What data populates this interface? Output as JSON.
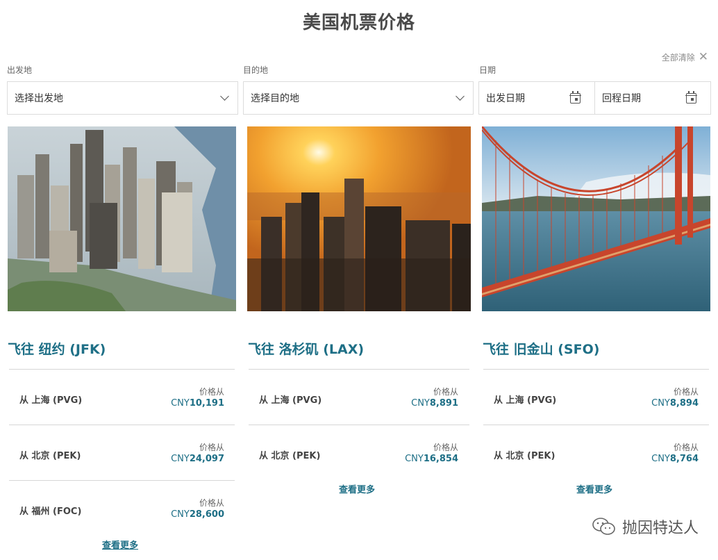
{
  "page_title": "美国机票价格",
  "clear_all": "全部清除",
  "filters": {
    "origin": {
      "label": "出发地",
      "value": "选择出发地"
    },
    "destination": {
      "label": "目的地",
      "value": "选择目的地"
    },
    "date": {
      "label": "日期",
      "depart": "出发日期",
      "return": "回程日期"
    }
  },
  "cards": [
    {
      "title": "飞往 纽约 (JFK)",
      "routes": [
        {
          "from": "从 上海 (PVG)",
          "price_label": "价格从",
          "currency": "CNY",
          "amount": "10,191"
        },
        {
          "from": "从 北京 (PEK)",
          "price_label": "价格从",
          "currency": "CNY",
          "amount": "24,097"
        },
        {
          "from": "从 福州 (FOC)",
          "price_label": "价格从",
          "currency": "CNY",
          "amount": "28,600"
        }
      ],
      "more": "查看更多"
    },
    {
      "title": "飞往 洛杉矶 (LAX)",
      "routes": [
        {
          "from": "从 上海 (PVG)",
          "price_label": "价格从",
          "currency": "CNY",
          "amount": "8,891"
        },
        {
          "from": "从 北京 (PEK)",
          "price_label": "价格从",
          "currency": "CNY",
          "amount": "16,854"
        }
      ],
      "more": "查看更多"
    },
    {
      "title": "飞往 旧金山 (SFO)",
      "routes": [
        {
          "from": "从 上海 (PVG)",
          "price_label": "价格从",
          "currency": "CNY",
          "amount": "8,894"
        },
        {
          "from": "从 北京 (PEK)",
          "price_label": "价格从",
          "currency": "CNY",
          "amount": "8,764"
        }
      ],
      "more": "查看更多"
    }
  ],
  "watermark": "抛因特达人",
  "colors": {
    "accent": "#1e6f86",
    "title": "#4a4a4a",
    "border": "#dcdcdc"
  }
}
